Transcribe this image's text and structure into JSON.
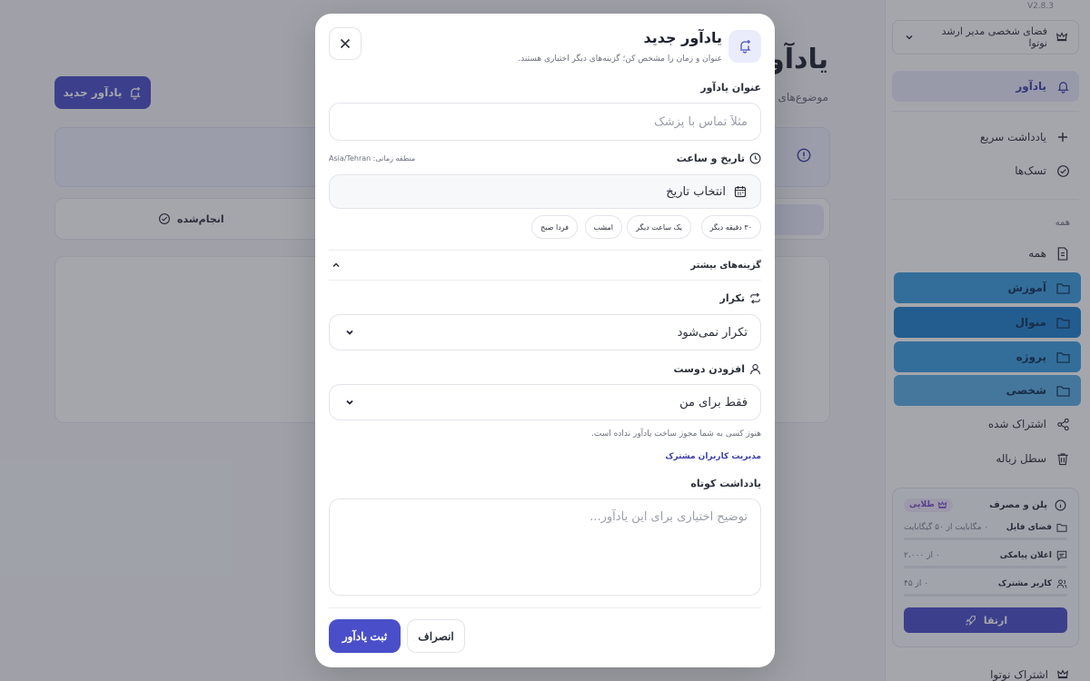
{
  "app": {
    "version": "V2.8.3",
    "workspace_label": "فضای شخصی مدیر ارشد نوتوا",
    "page_title": "یادآور",
    "page_subtitle": "موضوع‌های",
    "new_button": "یادآور جدید",
    "done_filter": "انجام‌شده"
  },
  "sidebar": {
    "active_item": "یادآور",
    "quick_note": "یادداشت سریع",
    "tasks": "تسک‌ها",
    "section_all": "همه",
    "all_item": "همه",
    "folders": [
      {
        "label": "آموزش",
        "color": "#3b9fe0"
      },
      {
        "label": "منوال",
        "color": "#1f82cf"
      },
      {
        "label": "پروژه",
        "color": "#3b9fe0"
      },
      {
        "label": "شخصی",
        "color": "#5aaee6"
      }
    ],
    "shared": "اشتراک شده",
    "trash": "سطل زباله",
    "plan": {
      "title": "پلن و مصرف",
      "badge": "طلایی",
      "rows": [
        {
          "label": "فضای فایل",
          "value": "۰ مگابایت از ۵۰ گیگابایت"
        },
        {
          "label": "اعلان پیامکی",
          "value": "۰ از ۲،۰۰۰"
        },
        {
          "label": "کاربر مشترک",
          "value": "۰ از ۴۵"
        }
      ],
      "upgrade": "ارتقا"
    },
    "bottom": "اشتراک نوتوا"
  },
  "modal": {
    "title": "یادآور جدید",
    "subtitle": "عنوان و زمان را مشخص کن؛ گزینه‌های دیگر اختیاری هستند.",
    "title_label": "عنوان یادآور",
    "title_placeholder": "مثلاً تماس با پزشک",
    "datetime_label": "تاریخ و ساعت",
    "timezone": "منطقه زمانی: Asia/Tehran",
    "date_placeholder": "انتخاب تاریخ",
    "quick_chips": [
      "۳۰ دقیقه دیگر",
      "یک ساعت دیگر",
      "امشب",
      "فردا صبح"
    ],
    "more_options": "گزینه‌های بیشتر",
    "repeat_label": "تکرار",
    "repeat_value": "تکرار نمی‌شود",
    "friend_label": "افزودن دوست",
    "friend_value": "فقط برای من",
    "no_permission_hint": "هنوز کسی به شما مجوز ساخت یادآور نداده است.",
    "manage_link": "مدیریت کاربران مشترک",
    "note_label": "یادداشت کوتاه",
    "note_placeholder": "توضیح اختیاری برای این یادآور...",
    "cancel": "انصراف",
    "submit": "ثبت یادآور"
  },
  "colors": {
    "accent": "#4a4fc9",
    "accent_light": "#ebecfb"
  }
}
